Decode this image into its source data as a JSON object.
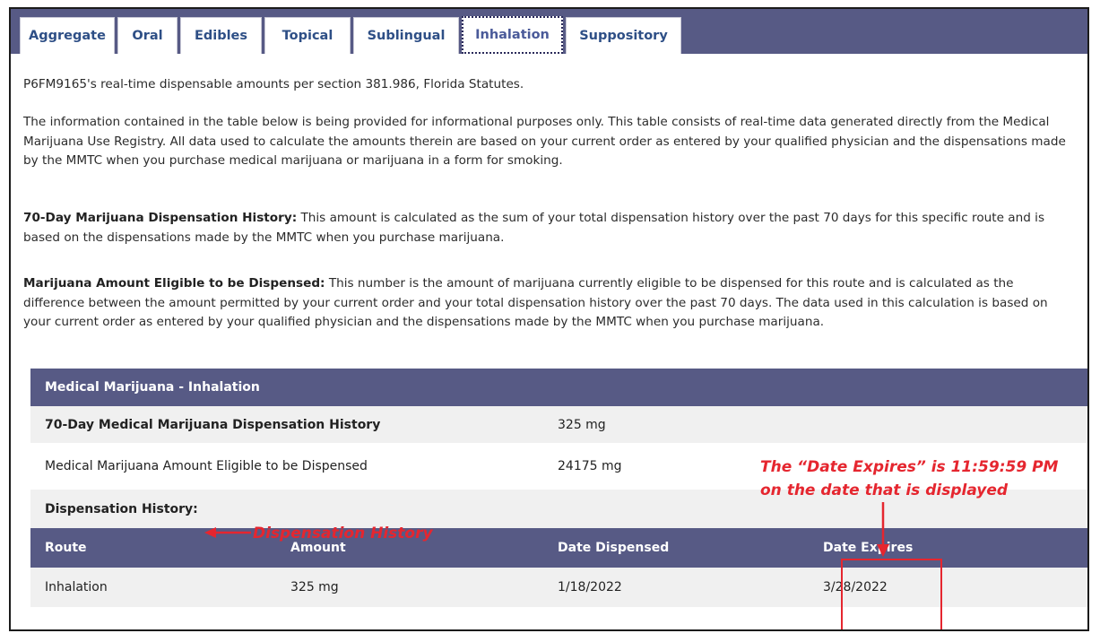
{
  "tabs": [
    {
      "label": "Aggregate"
    },
    {
      "label": "Oral"
    },
    {
      "label": "Edibles"
    },
    {
      "label": "Topical"
    },
    {
      "label": "Sublingual"
    },
    {
      "label": "Inhalation"
    },
    {
      "label": "Suppository"
    }
  ],
  "active_tab": "Inhalation",
  "intro": {
    "line": "P6FM9165's real-time dispensable amounts per section 381.986, Florida Statutes.",
    "disclaimer": "The information contained in the table below is being provided for informational purposes only. This table consists of real-time data generated directly from the Medical Marijuana Use Registry. All data used to calculate the amounts therein are based on your current order as entered by your qualified physician and the dispensations made by the MMTC when you purchase medical marijuana or marijuana in a form for smoking.",
    "history_term": "70-Day Marijuana Dispensation History:",
    "history_def": " This amount is calculated as the sum of your total dispensation history over the past 70 days for this specific route and is based on the dispensations made by the MMTC when you purchase marijuana.",
    "eligible_term": "Marijuana Amount Eligible to be Dispensed:",
    "eligible_def": " This number is the amount of marijuana currently eligible to be dispensed for this route and is calculated as the difference between the amount permitted by your current order and your total dispensation history over the past 70 days. The data used in this calculation is based on your current order as entered by your qualified physician and the dispensations made by the MMTC when you purchase marijuana."
  },
  "summary_table": {
    "title": "Medical Marijuana - Inhalation",
    "rows": [
      {
        "label": "70-Day Medical Marijuana Dispensation History",
        "value": "325 mg"
      },
      {
        "label": "Medical Marijuana Amount Eligible to be Dispensed",
        "value": "24175 mg"
      }
    ]
  },
  "dispensation_history": {
    "label": "Dispensation History:",
    "columns": [
      "Route",
      "Amount",
      "Date Dispensed",
      "Date Expires"
    ],
    "rows": [
      {
        "route": "Inhalation",
        "amount": "325 mg",
        "date_dispensed": "1/18/2022",
        "date_expires": "3/28/2022"
      }
    ]
  },
  "annotations": {
    "history_callout": "Dispensation History",
    "expires_line1": "The “Date Expires” is 11:59:59 PM",
    "expires_line2": "on the date that is displayed",
    "color": "#e5262f"
  },
  "colors": {
    "header_bg": "#575a85",
    "tab_text": "#2e4f86",
    "row_gray": "#f0f0f0"
  }
}
